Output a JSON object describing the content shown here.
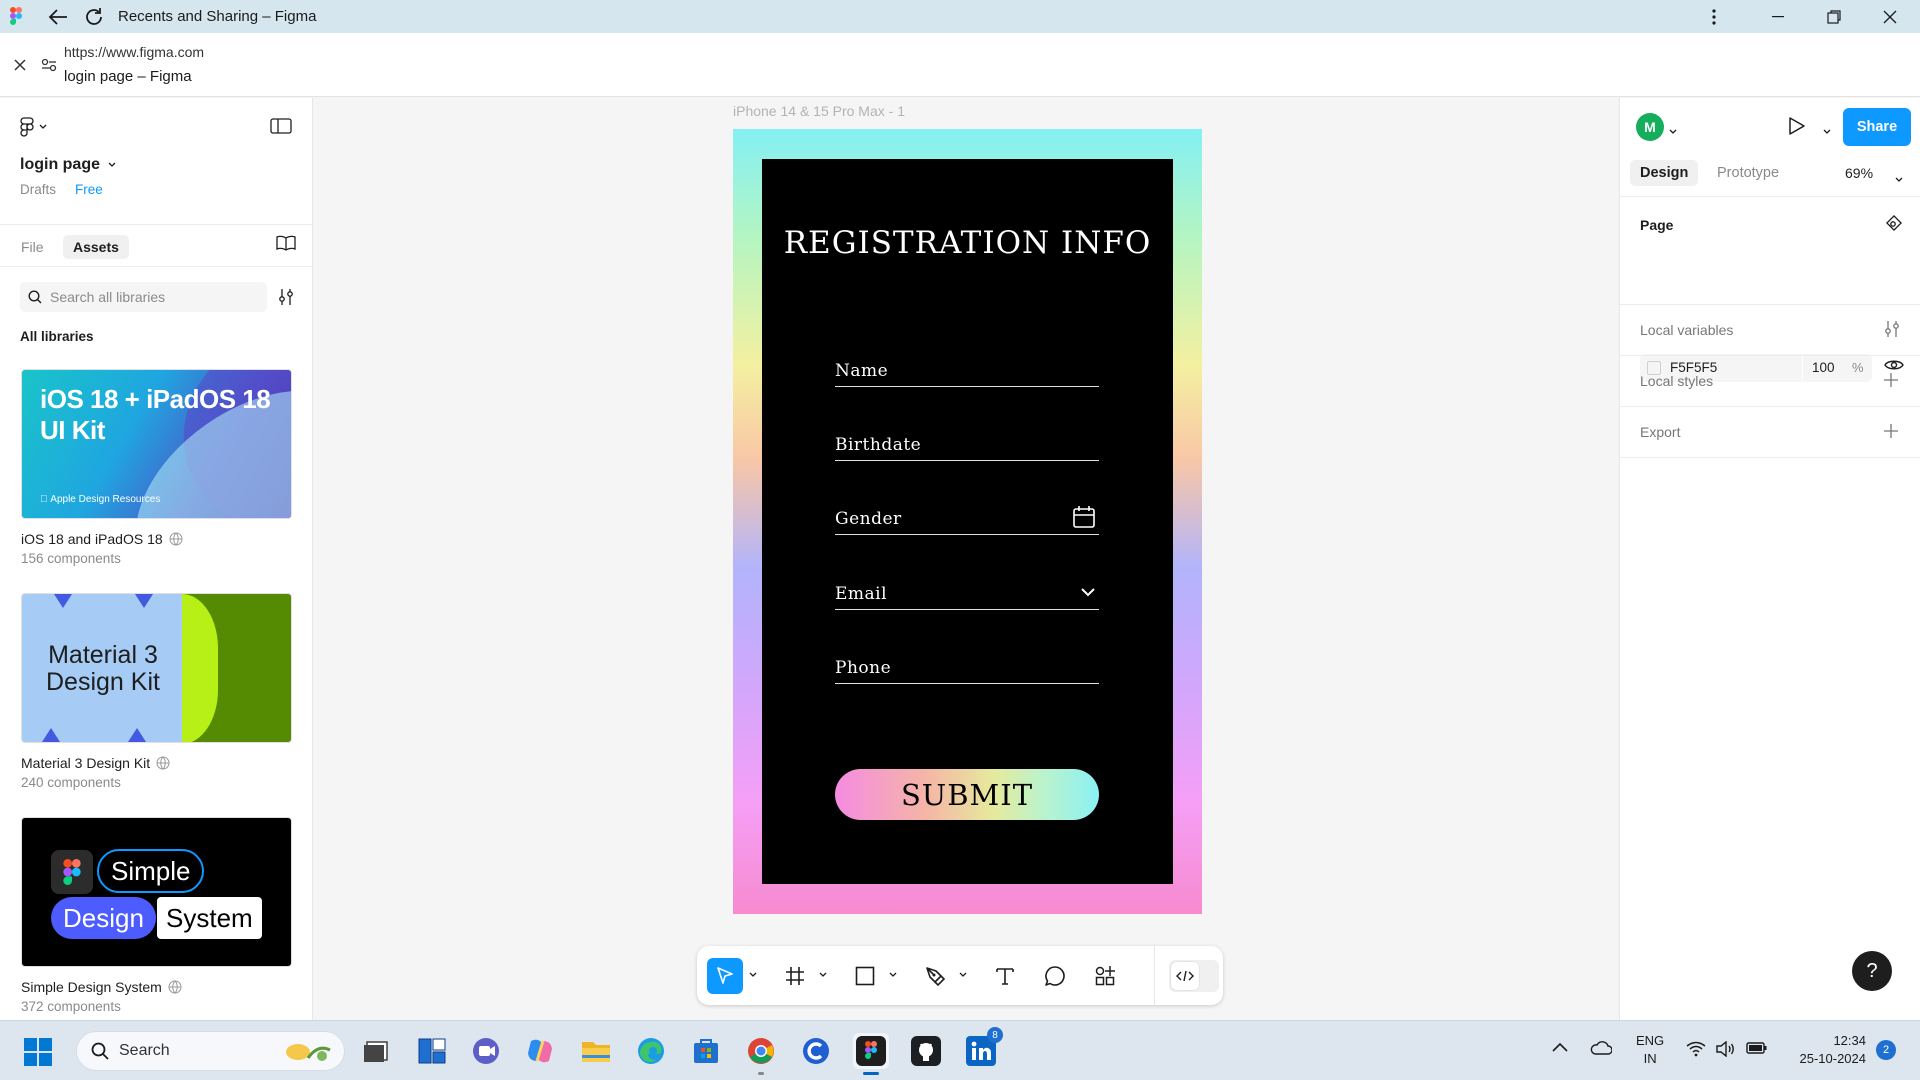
{
  "browser": {
    "tab_title": "Recents and Sharing – Figma",
    "url": "https://www.figma.com",
    "page_subtitle": "login page – Figma"
  },
  "left_panel": {
    "file_name": "login page",
    "location": "Drafts",
    "plan": "Free",
    "tabs": [
      "File",
      "Assets"
    ],
    "active_tab": "Assets",
    "search_placeholder": "Search all libraries",
    "section_title": "All libraries",
    "libraries": [
      {
        "name": "iOS 18 and iPadOS 18",
        "count": "156 components",
        "thumb_title": "iOS 18 + iPadOS 18 UI Kit",
        "thumb_line1": "iOS 18 + iPadOS 18",
        "thumb_line2": "UI Kit",
        "thumb_caption": "Apple Design Resources"
      },
      {
        "name": "Material 3 Design Kit",
        "count": "240 components",
        "thumb_line1": "Material 3",
        "thumb_line2": "Design Kit"
      },
      {
        "name": "Simple Design System",
        "count": "372 components",
        "thumb_words": [
          "Simple",
          "Design",
          "System"
        ]
      }
    ]
  },
  "canvas": {
    "frame_label": "iPhone 14 & 15 Pro Max - 1",
    "form": {
      "title": "REGISTRATION INFO",
      "fields": [
        "Name",
        "Birthdate",
        "Gender",
        "Email",
        "Phone"
      ],
      "submit_label": "SUBMIT"
    },
    "toolbar": {
      "tools": [
        "move",
        "frame",
        "rectangle",
        "pen",
        "text",
        "comment",
        "actions"
      ],
      "active_tool": "move",
      "dev_mode": false
    }
  },
  "right_panel": {
    "avatar_initial": "M",
    "share_label": "Share",
    "tabs": [
      "Design",
      "Prototype"
    ],
    "active_tab": "Design",
    "zoom": "69%",
    "page_section": "Page",
    "page_color": "F5F5F5",
    "page_opacity": "100",
    "page_opacity_unit": "%",
    "sections": [
      "Local variables",
      "Local styles",
      "Export"
    ],
    "help_label": "?"
  },
  "taskbar": {
    "search_label": "Search",
    "apps": [
      "task-view",
      "widgets",
      "teams-chat",
      "copilot",
      "file-explorer",
      "edge",
      "microsoft-store",
      "chrome",
      "c-app",
      "figma",
      "github",
      "linkedin"
    ],
    "linkedin_badge": "8",
    "lang_line1": "ENG",
    "lang_line2": "IN",
    "time": "12:34",
    "date": "25-10-2024",
    "notifications": "2"
  },
  "colors": {
    "figma_blue": "#0d99ff",
    "avatar_green": "#14ae5c",
    "frame_bg": "#000000"
  }
}
